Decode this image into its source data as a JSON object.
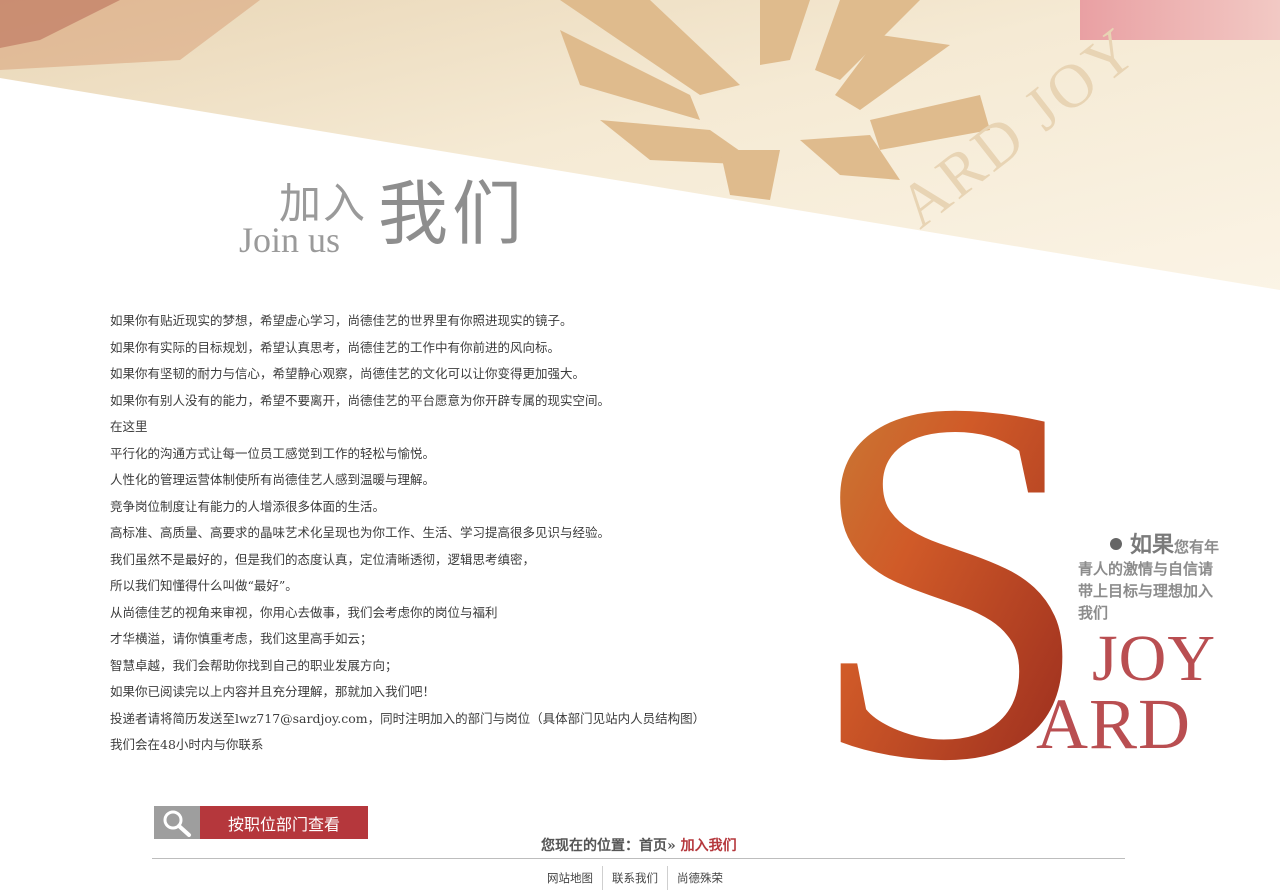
{
  "header": {
    "title_zh_small": "加入",
    "title_en": "Join us",
    "title_zh_big": "我们",
    "banner_text": "ARD JOY"
  },
  "intro_lines": [
    "如果你有贴近现实的梦想，希望虚心学习，尚德佳艺的世界里有你照进现实的镜子。",
    "如果你有实际的目标规划，希望认真思考，尚德佳艺的工作中有你前进的风向标。",
    "如果你有坚韧的耐力与信心，希望静心观察，尚德佳艺的文化可以让你变得更加强大。",
    "如果你有别人没有的能力，希望不要离开，尚德佳艺的平台愿意为你开辟专属的现实空间。",
    "在这里",
    "平行化的沟通方式让每一位员工感觉到工作的轻松与愉悦。",
    "人性化的管理运营体制使所有尚德佳艺人感到温暖与理解。",
    "竞争岗位制度让有能力的人增添很多体面的生活。",
    "高标准、高质量、高要求的晶味艺术化呈现也为你工作、生活、学习提高很多见识与经验。",
    "我们虽然不是最好的，但是我们的态度认真，定位清晰透彻，逻辑思考缜密，",
    "所以我们知懂得什么叫做“最好”。",
    "从尚德佳艺的视角来审视，你用心去做事，我们会考虑你的岗位与福利",
    "才华横溢，请你慎重考虑，我们这里高手如云；",
    "智慧卓越，我们会帮助你找到自己的职业发展方向；",
    "如果你已阅读完以上内容并且充分理解，那就加入我们吧！",
    "投递者请将简历发送至lwz717@sardjoy.com，同时注明加入的部门与岗位（具体部门见站内人员结构图）",
    "我们会在48小时内与你联系"
  ],
  "pitch": {
    "lead": "如果",
    "line1_rest": "您有年",
    "line2": "青人的激情与自信请",
    "line3": "带上目标与理想加入",
    "line4": "我们"
  },
  "logo": {
    "letter": "S",
    "joy": "JOY",
    "ard": "ARD"
  },
  "dept_button": {
    "icon": "search-icon",
    "label": "按职位部门查看"
  },
  "breadcrumb": {
    "prefix": "您现在的位置：",
    "home": "首页",
    "sep": "»",
    "current": "加入我们"
  },
  "footer_links": [
    "网站地图",
    "联系我们",
    "尚德殊荣"
  ],
  "colors": {
    "accent": "#b5373c",
    "logo_red": "#b94e51",
    "title_gray": "#9a9a9a",
    "banner_cream": "#f6ecd6",
    "banner_tan": "#e0bd8e",
    "banner_pink": "#d9848e"
  }
}
